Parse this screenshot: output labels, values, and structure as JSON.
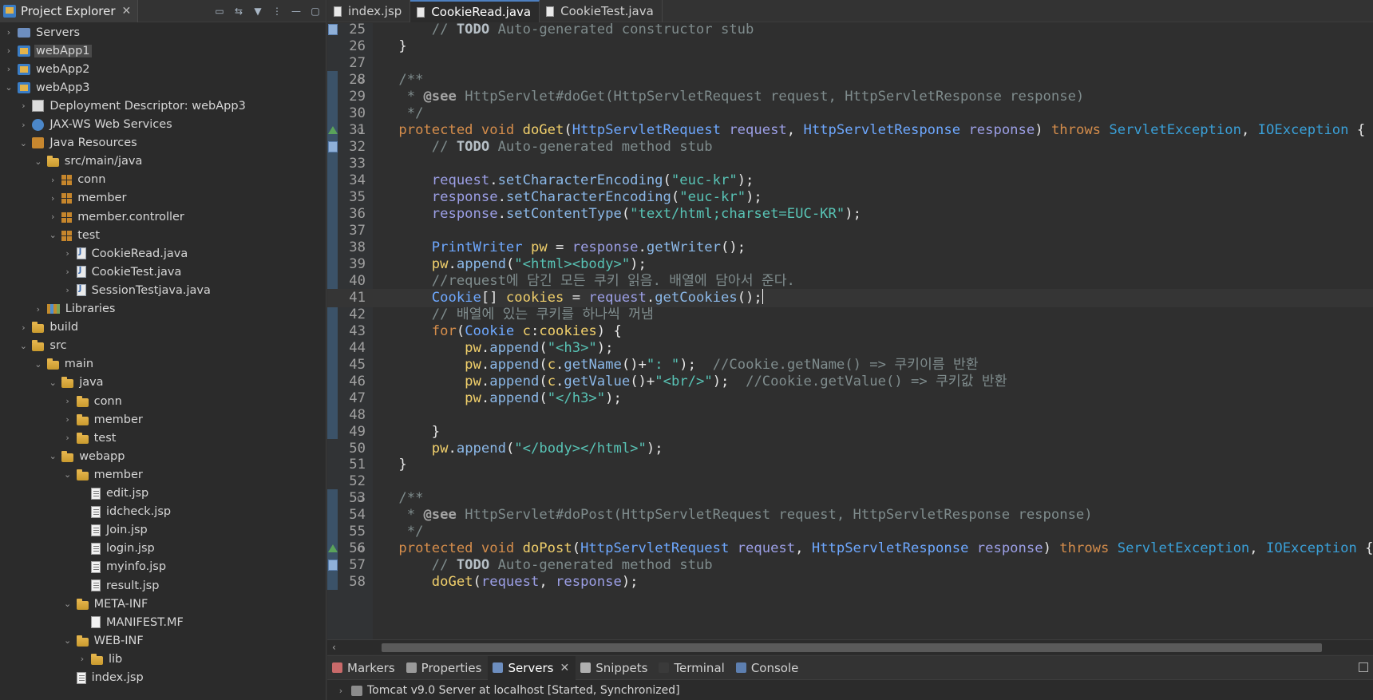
{
  "explorer": {
    "title": "Project Explorer",
    "tools": [
      "collapse-all-icon",
      "link-editor-icon",
      "filter-icon",
      "view-menu-icon",
      "minimize-icon",
      "maximize-icon"
    ],
    "items": [
      {
        "label": "Servers",
        "depth": 0,
        "chevron": "right",
        "icon": "servers"
      },
      {
        "label": "webApp1",
        "depth": 0,
        "chevron": "right",
        "icon": "project",
        "selected": true
      },
      {
        "label": "webApp2",
        "depth": 0,
        "chevron": "right",
        "icon": "project"
      },
      {
        "label": "webApp3",
        "depth": 0,
        "chevron": "down",
        "icon": "project"
      },
      {
        "label": "Deployment Descriptor: webApp3",
        "depth": 1,
        "chevron": "right",
        "icon": "descriptor"
      },
      {
        "label": "JAX-WS Web Services",
        "depth": 1,
        "chevron": "right",
        "icon": "webservice"
      },
      {
        "label": "Java Resources",
        "depth": 1,
        "chevron": "down",
        "icon": "javares"
      },
      {
        "label": "src/main/java",
        "depth": 2,
        "chevron": "down",
        "icon": "folder"
      },
      {
        "label": "conn",
        "depth": 3,
        "chevron": "right",
        "icon": "package"
      },
      {
        "label": "member",
        "depth": 3,
        "chevron": "right",
        "icon": "package"
      },
      {
        "label": "member.controller",
        "depth": 3,
        "chevron": "right",
        "icon": "package"
      },
      {
        "label": "test",
        "depth": 3,
        "chevron": "down",
        "icon": "package"
      },
      {
        "label": "CookieRead.java",
        "depth": 4,
        "chevron": "right",
        "icon": "java"
      },
      {
        "label": "CookieTest.java",
        "depth": 4,
        "chevron": "right",
        "icon": "java"
      },
      {
        "label": "SessionTestjava.java",
        "depth": 4,
        "chevron": "right",
        "icon": "java"
      },
      {
        "label": "Libraries",
        "depth": 2,
        "chevron": "right",
        "icon": "library"
      },
      {
        "label": "build",
        "depth": 1,
        "chevron": "right",
        "icon": "folder"
      },
      {
        "label": "src",
        "depth": 1,
        "chevron": "down",
        "icon": "folder"
      },
      {
        "label": "main",
        "depth": 2,
        "chevron": "down",
        "icon": "folder"
      },
      {
        "label": "java",
        "depth": 3,
        "chevron": "down",
        "icon": "folder"
      },
      {
        "label": "conn",
        "depth": 4,
        "chevron": "right",
        "icon": "folder"
      },
      {
        "label": "member",
        "depth": 4,
        "chevron": "right",
        "icon": "folder"
      },
      {
        "label": "test",
        "depth": 4,
        "chevron": "right",
        "icon": "folder"
      },
      {
        "label": "webapp",
        "depth": 3,
        "chevron": "down",
        "icon": "folder"
      },
      {
        "label": "member",
        "depth": 4,
        "chevron": "down",
        "icon": "folder"
      },
      {
        "label": "edit.jsp",
        "depth": 5,
        "chevron": "none",
        "icon": "jsp"
      },
      {
        "label": "idcheck.jsp",
        "depth": 5,
        "chevron": "none",
        "icon": "jsp"
      },
      {
        "label": "Join.jsp",
        "depth": 5,
        "chevron": "none",
        "icon": "jsp"
      },
      {
        "label": "login.jsp",
        "depth": 5,
        "chevron": "none",
        "icon": "jsp"
      },
      {
        "label": "myinfo.jsp",
        "depth": 5,
        "chevron": "none",
        "icon": "jsp"
      },
      {
        "label": "result.jsp",
        "depth": 5,
        "chevron": "none",
        "icon": "jsp"
      },
      {
        "label": "META-INF",
        "depth": 4,
        "chevron": "down",
        "icon": "folder"
      },
      {
        "label": "MANIFEST.MF",
        "depth": 5,
        "chevron": "none",
        "icon": "manifest"
      },
      {
        "label": "WEB-INF",
        "depth": 4,
        "chevron": "down",
        "icon": "folder"
      },
      {
        "label": "lib",
        "depth": 5,
        "chevron": "right",
        "icon": "folder"
      },
      {
        "label": "index.jsp",
        "depth": 4,
        "chevron": "none",
        "icon": "jsp"
      }
    ]
  },
  "editor": {
    "tabs": [
      {
        "label": "index.jsp",
        "active": false
      },
      {
        "label": "CookieRead.java",
        "active": true
      },
      {
        "label": "CookieTest.java",
        "active": false
      }
    ],
    "lines": [
      {
        "n": "25",
        "gutter": "task",
        "tokens": [
          [
            "c",
            "        // "
          ],
          [
            "ctodo",
            "TODO"
          ],
          [
            "c",
            " Auto-generated constructor stub"
          ]
        ]
      },
      {
        "n": "26",
        "tokens": [
          [
            "p",
            "    }"
          ]
        ]
      },
      {
        "n": "27",
        "tokens": [
          [
            "p",
            ""
          ]
        ]
      },
      {
        "n": "28",
        "fold": true,
        "tokens": [
          [
            "jd",
            "    /**"
          ]
        ]
      },
      {
        "n": "29",
        "tokens": [
          [
            "jd",
            "     * "
          ],
          [
            "jdtag",
            "@see"
          ],
          [
            "jd",
            " HttpServlet#doGet(HttpServletRequest request, HttpServletResponse response)"
          ]
        ]
      },
      {
        "n": "30",
        "tokens": [
          [
            "jd",
            "     */"
          ]
        ]
      },
      {
        "n": "31",
        "fold": true,
        "gutter": "override",
        "tokens": [
          [
            "kw",
            "    protected void "
          ],
          [
            "m",
            "doGet"
          ],
          [
            "p",
            "("
          ],
          [
            "t",
            "HttpServletRequest "
          ],
          [
            "v",
            "request"
          ],
          [
            "p",
            ", "
          ],
          [
            "t",
            "HttpServletResponse "
          ],
          [
            "v",
            "response"
          ],
          [
            "p",
            ") "
          ],
          [
            "kw",
            "throws "
          ],
          [
            "tb",
            "ServletException"
          ],
          [
            "p",
            ", "
          ],
          [
            "tb",
            "IOException"
          ],
          [
            "p",
            " {"
          ]
        ]
      },
      {
        "n": "32",
        "gutter": "task",
        "tokens": [
          [
            "c",
            "        // "
          ],
          [
            "ctodo",
            "TODO"
          ],
          [
            "c",
            " Auto-generated method stub"
          ]
        ]
      },
      {
        "n": "33",
        "tokens": [
          [
            "p",
            ""
          ]
        ]
      },
      {
        "n": "34",
        "tokens": [
          [
            "v",
            "        request"
          ],
          [
            "p",
            "."
          ],
          [
            "call",
            "setCharacterEncoding"
          ],
          [
            "p",
            "("
          ],
          [
            "s",
            "\"euc-kr\""
          ],
          [
            "p",
            ");"
          ]
        ]
      },
      {
        "n": "35",
        "tokens": [
          [
            "v",
            "        response"
          ],
          [
            "p",
            "."
          ],
          [
            "call",
            "setCharacterEncoding"
          ],
          [
            "p",
            "("
          ],
          [
            "s",
            "\"euc-kr\""
          ],
          [
            "p",
            ");"
          ]
        ]
      },
      {
        "n": "36",
        "tokens": [
          [
            "v",
            "        response"
          ],
          [
            "p",
            "."
          ],
          [
            "call",
            "setContentType"
          ],
          [
            "p",
            "("
          ],
          [
            "s",
            "\"text/html;charset=EUC-KR\""
          ],
          [
            "p",
            ");"
          ]
        ]
      },
      {
        "n": "37",
        "tokens": [
          [
            "p",
            ""
          ]
        ]
      },
      {
        "n": "38",
        "tokens": [
          [
            "t",
            "        PrintWriter "
          ],
          [
            "vv",
            "pw"
          ],
          [
            "p",
            " = "
          ],
          [
            "v",
            "response"
          ],
          [
            "p",
            "."
          ],
          [
            "call",
            "getWriter"
          ],
          [
            "p",
            "();"
          ]
        ]
      },
      {
        "n": "39",
        "tokens": [
          [
            "vv",
            "        pw"
          ],
          [
            "p",
            "."
          ],
          [
            "call",
            "append"
          ],
          [
            "p",
            "("
          ],
          [
            "s",
            "\"<html><body>\""
          ],
          [
            "p",
            ");"
          ]
        ]
      },
      {
        "n": "40",
        "tokens": [
          [
            "c",
            "        //request에 담긴 모든 쿠키 읽음. 배열에 담아서 준다."
          ]
        ]
      },
      {
        "n": "41",
        "current": true,
        "tokens": [
          [
            "t",
            "        Cookie"
          ],
          [
            "p",
            "[] "
          ],
          [
            "vv",
            "cookies"
          ],
          [
            "p",
            " = "
          ],
          [
            "v",
            "request"
          ],
          [
            "p",
            "."
          ],
          [
            "call",
            "getCookies"
          ],
          [
            "p",
            "();"
          ]
        ]
      },
      {
        "n": "42",
        "tokens": [
          [
            "c",
            "        // 배열에 있는 쿠키를 하나씩 꺼냄"
          ]
        ]
      },
      {
        "n": "43",
        "tokens": [
          [
            "kw",
            "        for"
          ],
          [
            "p",
            "("
          ],
          [
            "t",
            "Cookie "
          ],
          [
            "vv",
            "c"
          ],
          [
            "p",
            ":"
          ],
          [
            "vv",
            "cookies"
          ],
          [
            "p",
            ") {"
          ]
        ]
      },
      {
        "n": "44",
        "tokens": [
          [
            "vv",
            "            pw"
          ],
          [
            "p",
            "."
          ],
          [
            "call",
            "append"
          ],
          [
            "p",
            "("
          ],
          [
            "s",
            "\"<h3>\""
          ],
          [
            "p",
            ");"
          ]
        ]
      },
      {
        "n": "45",
        "tokens": [
          [
            "vv",
            "            pw"
          ],
          [
            "p",
            "."
          ],
          [
            "call",
            "append"
          ],
          [
            "p",
            "("
          ],
          [
            "vv",
            "c"
          ],
          [
            "p",
            "."
          ],
          [
            "call",
            "getName"
          ],
          [
            "p",
            "()+"
          ],
          [
            "s",
            "\": \""
          ],
          [
            "p",
            ");  "
          ],
          [
            "c",
            "//Cookie.getName() => 쿠키이름 반환"
          ]
        ]
      },
      {
        "n": "46",
        "tokens": [
          [
            "vv",
            "            pw"
          ],
          [
            "p",
            "."
          ],
          [
            "call",
            "append"
          ],
          [
            "p",
            "("
          ],
          [
            "vv",
            "c"
          ],
          [
            "p",
            "."
          ],
          [
            "call",
            "getValue"
          ],
          [
            "p",
            "()+"
          ],
          [
            "s",
            "\"<br/>\""
          ],
          [
            "p",
            ");  "
          ],
          [
            "c",
            "//Cookie.getValue() => 쿠키값 반환"
          ]
        ]
      },
      {
        "n": "47",
        "tokens": [
          [
            "vv",
            "            pw"
          ],
          [
            "p",
            "."
          ],
          [
            "call",
            "append"
          ],
          [
            "p",
            "("
          ],
          [
            "s",
            "\"</h3>\""
          ],
          [
            "p",
            ");"
          ]
        ]
      },
      {
        "n": "48",
        "tokens": [
          [
            "p",
            ""
          ]
        ]
      },
      {
        "n": "49",
        "tokens": [
          [
            "p",
            "        }"
          ]
        ]
      },
      {
        "n": "50",
        "tokens": [
          [
            "vv",
            "        pw"
          ],
          [
            "p",
            "."
          ],
          [
            "call",
            "append"
          ],
          [
            "p",
            "("
          ],
          [
            "s",
            "\"</body></html>\""
          ],
          [
            "p",
            ");"
          ]
        ]
      },
      {
        "n": "51",
        "tokens": [
          [
            "p",
            "    }"
          ]
        ]
      },
      {
        "n": "52",
        "tokens": [
          [
            "p",
            ""
          ]
        ]
      },
      {
        "n": "53",
        "fold": true,
        "tokens": [
          [
            "jd",
            "    /**"
          ]
        ]
      },
      {
        "n": "54",
        "tokens": [
          [
            "jd",
            "     * "
          ],
          [
            "jdtag",
            "@see"
          ],
          [
            "jd",
            " HttpServlet#doPost(HttpServletRequest request, HttpServletResponse response)"
          ]
        ]
      },
      {
        "n": "55",
        "tokens": [
          [
            "jd",
            "     */"
          ]
        ]
      },
      {
        "n": "56",
        "fold": true,
        "gutter": "override",
        "tokens": [
          [
            "kw",
            "    protected void "
          ],
          [
            "m",
            "doPost"
          ],
          [
            "p",
            "("
          ],
          [
            "t",
            "HttpServletRequest "
          ],
          [
            "v",
            "request"
          ],
          [
            "p",
            ", "
          ],
          [
            "t",
            "HttpServletResponse "
          ],
          [
            "v",
            "response"
          ],
          [
            "p",
            ") "
          ],
          [
            "kw",
            "throws "
          ],
          [
            "tb",
            "ServletException"
          ],
          [
            "p",
            ", "
          ],
          [
            "tb",
            "IOException"
          ],
          [
            "p",
            " {"
          ]
        ]
      },
      {
        "n": "57",
        "gutter": "task",
        "tokens": [
          [
            "c",
            "        // "
          ],
          [
            "ctodo",
            "TODO"
          ],
          [
            "c",
            " Auto-generated method stub"
          ]
        ]
      },
      {
        "n": "58",
        "tokens": [
          [
            "m",
            "        doGet"
          ],
          [
            "p",
            "("
          ],
          [
            "v",
            "request"
          ],
          [
            "p",
            ", "
          ],
          [
            "v",
            "response"
          ],
          [
            "p",
            ");"
          ]
        ]
      }
    ]
  },
  "bottom": {
    "tabs": [
      {
        "label": "Markers",
        "active": false,
        "color": "#c96a6a"
      },
      {
        "label": "Properties",
        "active": false,
        "color": "#9a9a9a"
      },
      {
        "label": "Servers",
        "active": true,
        "color": "#6d8ebf"
      },
      {
        "label": "Snippets",
        "active": false,
        "color": "#b0b0b0"
      },
      {
        "label": "Terminal",
        "active": false,
        "color": "#3a3a3a"
      },
      {
        "label": "Console",
        "active": false,
        "color": "#5d7fb0"
      }
    ],
    "server": "Tomcat v9.0 Server at localhost  [Started, Synchronized]"
  }
}
